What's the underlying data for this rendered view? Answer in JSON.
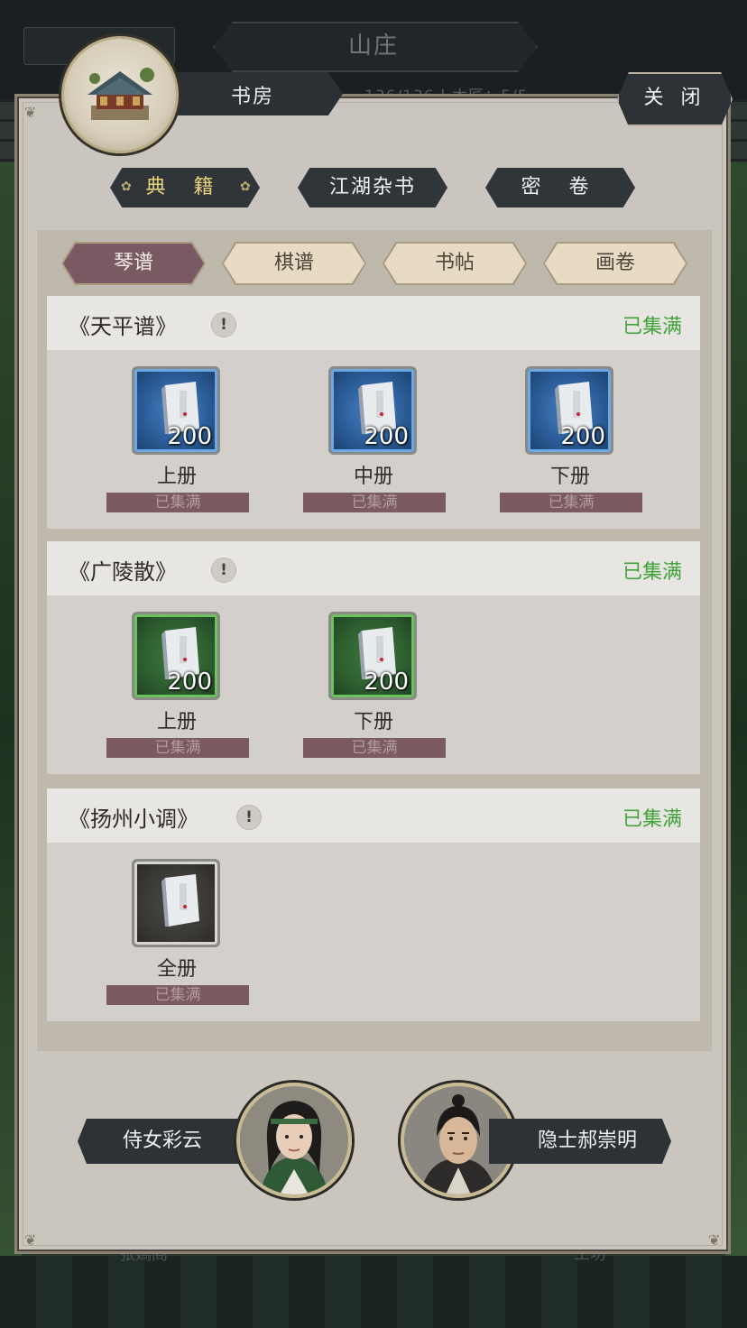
{
  "background": {
    "title": "山庄",
    "stats": "136/136  |  木匠：5/5",
    "bottom_left": "张嫣阁",
    "bottom_right": "工坊"
  },
  "header": {
    "room_name": "书房",
    "close_label": "关 闭"
  },
  "categories": [
    {
      "label": "典 籍",
      "active": true
    },
    {
      "label": "江湖杂书",
      "active": false
    },
    {
      "label": "密 卷",
      "active": false
    }
  ],
  "subtabs": [
    {
      "label": "琴谱",
      "active": true
    },
    {
      "label": "棋谱",
      "active": false
    },
    {
      "label": "书帖",
      "active": false
    },
    {
      "label": "画卷",
      "active": false
    }
  ],
  "sections": [
    {
      "title": "《天平谱》",
      "status": "已集满",
      "items": [
        {
          "name": "上册",
          "count": "200",
          "state": "已集满",
          "rarity": "blue"
        },
        {
          "name": "中册",
          "count": "200",
          "state": "已集满",
          "rarity": "blue"
        },
        {
          "name": "下册",
          "count": "200",
          "state": "已集满",
          "rarity": "blue"
        }
      ]
    },
    {
      "title": "《广陵散》",
      "status": "已集满",
      "items": [
        {
          "name": "上册",
          "count": "200",
          "state": "已集满",
          "rarity": "green"
        },
        {
          "name": "下册",
          "count": "200",
          "state": "已集满",
          "rarity": "green"
        }
      ]
    },
    {
      "title": "《扬州小调》",
      "status": "已集满",
      "items": [
        {
          "name": "全册",
          "count": "",
          "state": "已集满",
          "rarity": "white"
        }
      ]
    }
  ],
  "npcs": [
    {
      "name": "侍女彩云"
    },
    {
      "name": "隐士郝崇明"
    }
  ],
  "colors": {
    "collected_green": "#41a33a",
    "active_tab": "#7a5a62",
    "panel_bg": "#cbc6bd",
    "dark_plate": "#2d3236"
  },
  "icons": {
    "warning": "exclamation-circle-icon",
    "book": "book-volume-icon",
    "building": "study-house-icon"
  }
}
